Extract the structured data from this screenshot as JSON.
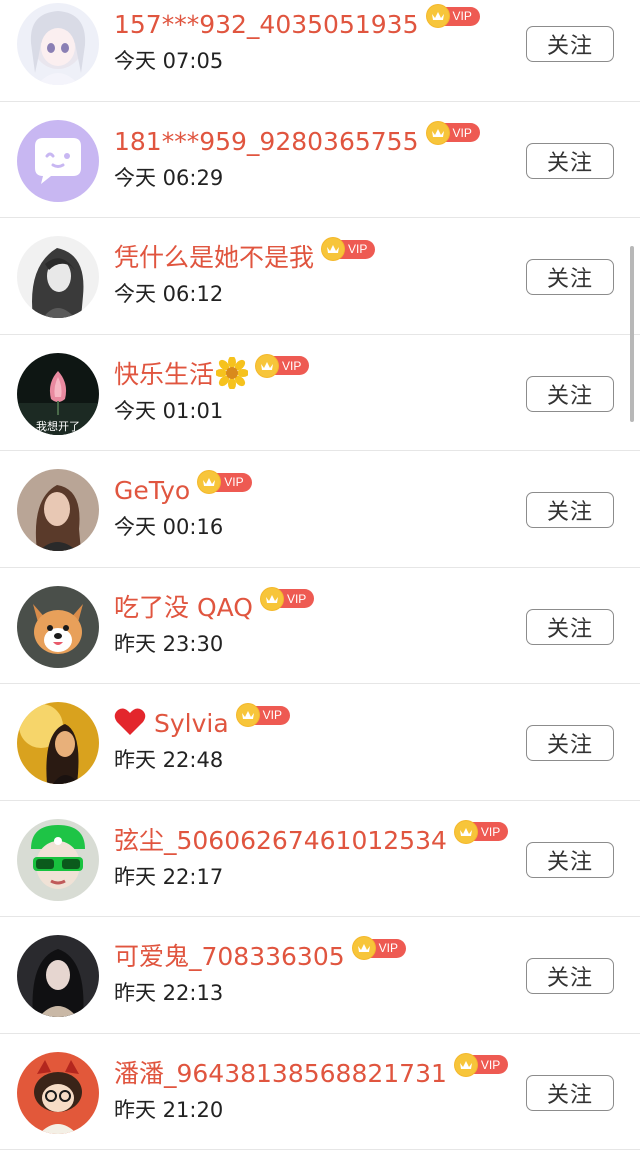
{
  "colors": {
    "name": "#e0553f",
    "vip_tag": "#ee5a52",
    "crown": "#f7c53a",
    "divider": "#e6e6e6"
  },
  "follow_label": "关注",
  "vip_label": "VIP",
  "users": [
    {
      "name": "157***932_4035051935",
      "time": "今天 07:05",
      "avatar": "anime-girl-avatar"
    },
    {
      "name": "181***959_9280365755",
      "time": "今天 06:29",
      "avatar": "chat-bubble-avatar"
    },
    {
      "name": "凭什么是她不是我",
      "time": "今天 06:12",
      "avatar": "dark-hair-girl-avatar"
    },
    {
      "name": "快乐生活",
      "time": "今天 01:01",
      "avatar": "lotus-avatar",
      "avatar_text": "我想开了",
      "suffix_icon": "sunflower-icon"
    },
    {
      "name": "GeTyo",
      "time": "今天 00:16",
      "avatar": "woman-photo-avatar"
    },
    {
      "name": "吃了没 QAQ",
      "time": "昨天 23:30",
      "avatar": "dog-avatar"
    },
    {
      "name": "Sylvia",
      "time": "昨天 22:48",
      "avatar": "golden-light-avatar",
      "prefix_icon": "heart-icon"
    },
    {
      "name": "弦尘_50606267461012534",
      "time": "昨天 22:17",
      "avatar": "green-hat-avatar"
    },
    {
      "name": "可爱鬼_708336305",
      "time": "昨天 22:13",
      "avatar": "black-hair-avatar"
    },
    {
      "name": "潘潘_96438138568821731",
      "time": "昨天 21:20",
      "avatar": "cartoon-girl-avatar"
    }
  ]
}
